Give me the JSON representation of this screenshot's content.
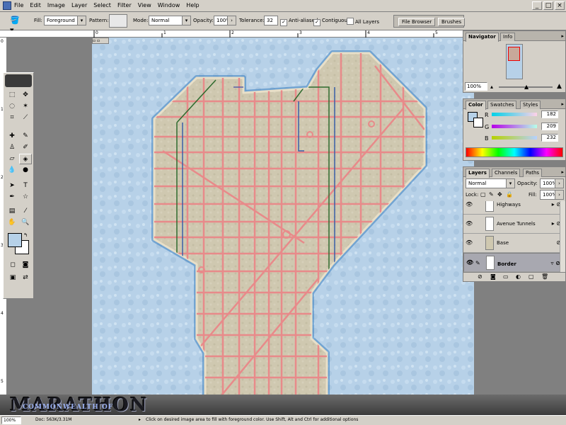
{
  "menubar": {
    "items": [
      "File",
      "Edit",
      "Image",
      "Layer",
      "Select",
      "Filter",
      "View",
      "Window",
      "Help"
    ],
    "window_buttons": [
      "_",
      "□",
      "×"
    ]
  },
  "options": {
    "fill_label": "Fill:",
    "fill_value": "Foreground",
    "pattern_label": "Pattern:",
    "mode_label": "Mode:",
    "mode_value": "Normal",
    "opacity_label": "Opacity:",
    "opacity_value": "100%",
    "tolerance_label": "Tolerance:",
    "tolerance_value": "32",
    "anti_aliased": "Anti-aliased",
    "contiguous": "Contiguous",
    "all_layers": "All Layers",
    "well_tabs": [
      "File Browser",
      "Brushes"
    ]
  },
  "navigator": {
    "tabs": [
      "Navigator",
      "Info"
    ],
    "zoom": "100%"
  },
  "color": {
    "tabs": [
      "Color",
      "Swatches",
      "Styles"
    ],
    "r_label": "R",
    "r": "182",
    "g_label": "G",
    "g": "209",
    "b_label": "B",
    "b": "232",
    "foreground": "#b6d1e8",
    "background": "#ffffff"
  },
  "layers": {
    "tabs": [
      "Layers",
      "Channels",
      "Paths"
    ],
    "blend_mode": "Normal",
    "opacity_label": "Opacity:",
    "opacity": "100%",
    "lock_label": "Lock:",
    "fill_label": "Fill:",
    "fill": "100%",
    "rows": [
      {
        "name": "Highways"
      },
      {
        "name": "Avenue Tunnels"
      },
      {
        "name": "Base"
      },
      {
        "name": "Border"
      }
    ]
  },
  "status": {
    "zoom": "100%",
    "doc": "Doc: 563K/3.31M",
    "hint": "Click on desired image area to fill with foreground color. Use Shift, Alt and Ctrl for additional options"
  },
  "watermark": {
    "main": "MARATHON",
    "sub": "COMMONWEALTH OF"
  },
  "ruler": {
    "top_ticks": [
      "0",
      "1",
      "2",
      "3",
      "4",
      "5",
      "6"
    ],
    "left_ticks": [
      "0",
      "1",
      "2",
      "3",
      "4",
      "5"
    ]
  }
}
